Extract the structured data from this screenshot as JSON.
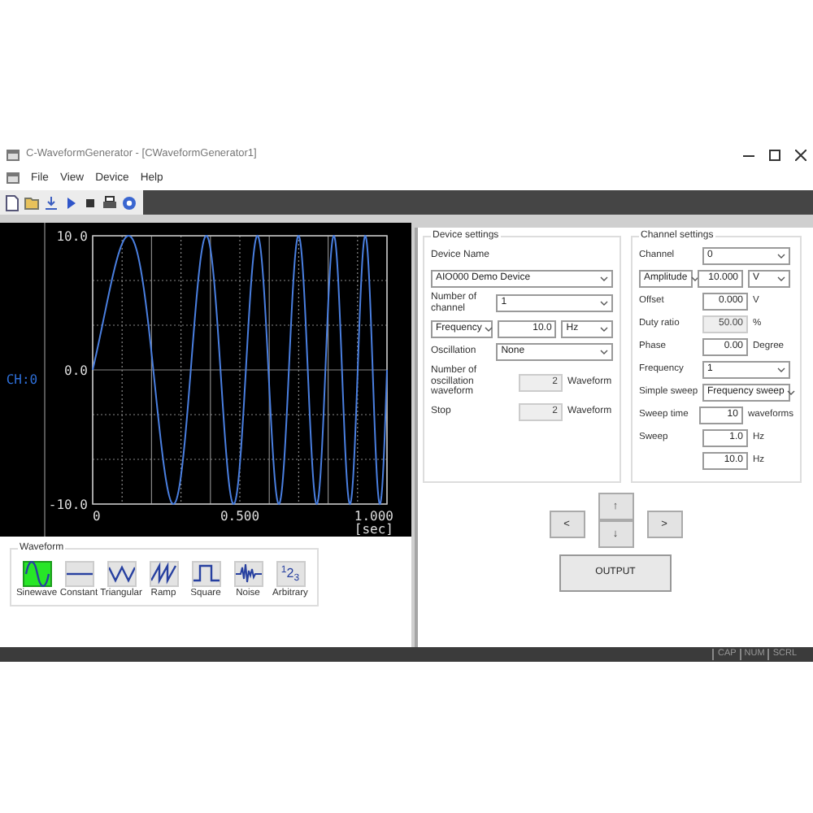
{
  "window": {
    "title": "C-WaveformGenerator - [CWaveformGenerator1]"
  },
  "menu": [
    "File",
    "View",
    "Device",
    "Help"
  ],
  "plot": {
    "channel_label": "CH:0",
    "y_labels": [
      "10.0",
      "0.0",
      "-10.0"
    ],
    "x_labels": [
      "0",
      "0.500",
      "1.000"
    ],
    "x_unit": "[sec]"
  },
  "waveform": {
    "title": "Waveform",
    "items": [
      {
        "kind": "sine",
        "label": "Sinewave",
        "selected": true
      },
      {
        "kind": "constant",
        "label": "Constant",
        "selected": false
      },
      {
        "kind": "triangle",
        "label": "Triangular",
        "selected": false
      },
      {
        "kind": "ramp",
        "label": "Ramp",
        "selected": false
      },
      {
        "kind": "square",
        "label": "Square",
        "selected": false
      },
      {
        "kind": "noise",
        "label": "Noise",
        "selected": false
      },
      {
        "kind": "arbitrary",
        "label": "Arbitrary",
        "selected": false,
        "glyph": "$^{1}$2$_{3}$"
      }
    ]
  },
  "device_settings": {
    "title": "Device settings",
    "device_name_label": "Device Name",
    "device_name": "AIO000 Demo Device",
    "rows": [
      {
        "kind": "select",
        "label": "Number of channel",
        "value": "1"
      },
      {
        "kind": "select_pair",
        "select": "Frequency",
        "value": "10.0",
        "unit_select": "Hz"
      },
      {
        "kind": "select",
        "label": "Oscillation",
        "value": "None"
      },
      {
        "kind": "readonly",
        "label": "Number of oscillation waveform",
        "value": "2",
        "unit": "Waveform"
      },
      {
        "kind": "readonly",
        "label": "Stop",
        "value": "2",
        "unit": "Waveform"
      }
    ]
  },
  "channel_settings": {
    "title": "Channel settings",
    "rows": [
      {
        "kind": "select",
        "label": "Channel",
        "value": "0"
      },
      {
        "kind": "select_pair",
        "select": "Amplitude",
        "value": "10.000",
        "unit_select": "V"
      },
      {
        "kind": "input",
        "label": "Offset",
        "value": "0.000",
        "unit": "V"
      },
      {
        "kind": "readonly",
        "label": "Duty ratio",
        "value": "50.00",
        "unit": "%"
      },
      {
        "kind": "input",
        "label": "Phase",
        "value": "0.00",
        "unit": "Degree"
      },
      {
        "kind": "select",
        "label": "Frequency",
        "value": "1"
      },
      {
        "kind": "select",
        "label": "Simple sweep",
        "value": "Frequency sweep"
      },
      {
        "kind": "input",
        "label": "Sweep time",
        "value": "10",
        "unit": "waveforms"
      },
      {
        "kind": "input",
        "label": "Sweep",
        "value": "1.0",
        "unit": "Hz"
      },
      {
        "kind": "input",
        "value": "10.0",
        "unit": "Hz"
      }
    ]
  },
  "nav_buttons": {
    "up": "↑",
    "left": "<",
    "right": ">",
    "down": "↓"
  },
  "output_button": "OUTPUT",
  "status_bar": [
    "CAP",
    "NUM",
    "SCRL"
  ]
}
